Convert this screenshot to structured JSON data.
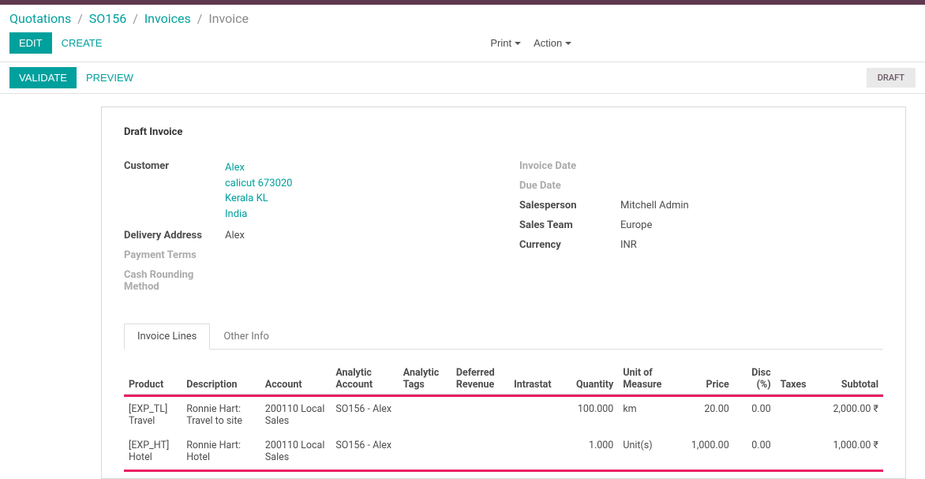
{
  "breadcrumb": {
    "items": [
      "Quotations",
      "SO156",
      "Invoices"
    ],
    "current": "Invoice"
  },
  "buttons": {
    "edit": "EDIT",
    "create": "CREATE",
    "print": "Print",
    "action": "Action",
    "validate": "VALIDATE",
    "preview": "PREVIEW"
  },
  "status": {
    "draft": "DRAFT"
  },
  "title": "Draft Invoice",
  "left_fields": {
    "customer_label": "Customer",
    "customer_name": "Alex",
    "customer_addr1": "calicut 673020",
    "customer_addr2": "Kerala KL",
    "customer_addr3": "India",
    "delivery_label": "Delivery Address",
    "delivery_value": "Alex",
    "payment_terms_label": "Payment Terms",
    "cash_rounding_label": "Cash Rounding Method"
  },
  "right_fields": {
    "invoice_date_label": "Invoice Date",
    "due_date_label": "Due Date",
    "salesperson_label": "Salesperson",
    "salesperson_value": "Mitchell Admin",
    "sales_team_label": "Sales Team",
    "sales_team_value": "Europe",
    "currency_label": "Currency",
    "currency_value": "INR"
  },
  "tabs": {
    "invoice_lines": "Invoice Lines",
    "other_info": "Other Info"
  },
  "columns": {
    "product": "Product",
    "description": "Description",
    "account": "Account",
    "analytic_account": "Analytic Account",
    "analytic_tags": "Analytic Tags",
    "deferred_revenue": "Deferred Revenue",
    "intrastat": "Intrastat",
    "quantity": "Quantity",
    "uom": "Unit of Measure",
    "price": "Price",
    "disc": "Disc (%)",
    "taxes": "Taxes",
    "subtotal": "Subtotal"
  },
  "rows": [
    {
      "product": "[EXP_TL] Travel",
      "description": "Ronnie Hart: Travel to site",
      "account": "200110 Local Sales",
      "analytic_account": "SO156 - Alex",
      "analytic_tags": "",
      "deferred_revenue": "",
      "intrastat": "",
      "quantity": "100.000",
      "uom": "km",
      "price": "20.00",
      "disc": "0.00",
      "taxes": "",
      "subtotal": "2,000.00 ₹"
    },
    {
      "product": "[EXP_HT] Hotel",
      "description": "Ronnie Hart: Hotel",
      "account": "200110 Local Sales",
      "analytic_account": "SO156 - Alex",
      "analytic_tags": "",
      "deferred_revenue": "",
      "intrastat": "",
      "quantity": "1.000",
      "uom": "Unit(s)",
      "price": "1,000.00",
      "disc": "0.00",
      "taxes": "",
      "subtotal": "1,000.00 ₹"
    }
  ]
}
